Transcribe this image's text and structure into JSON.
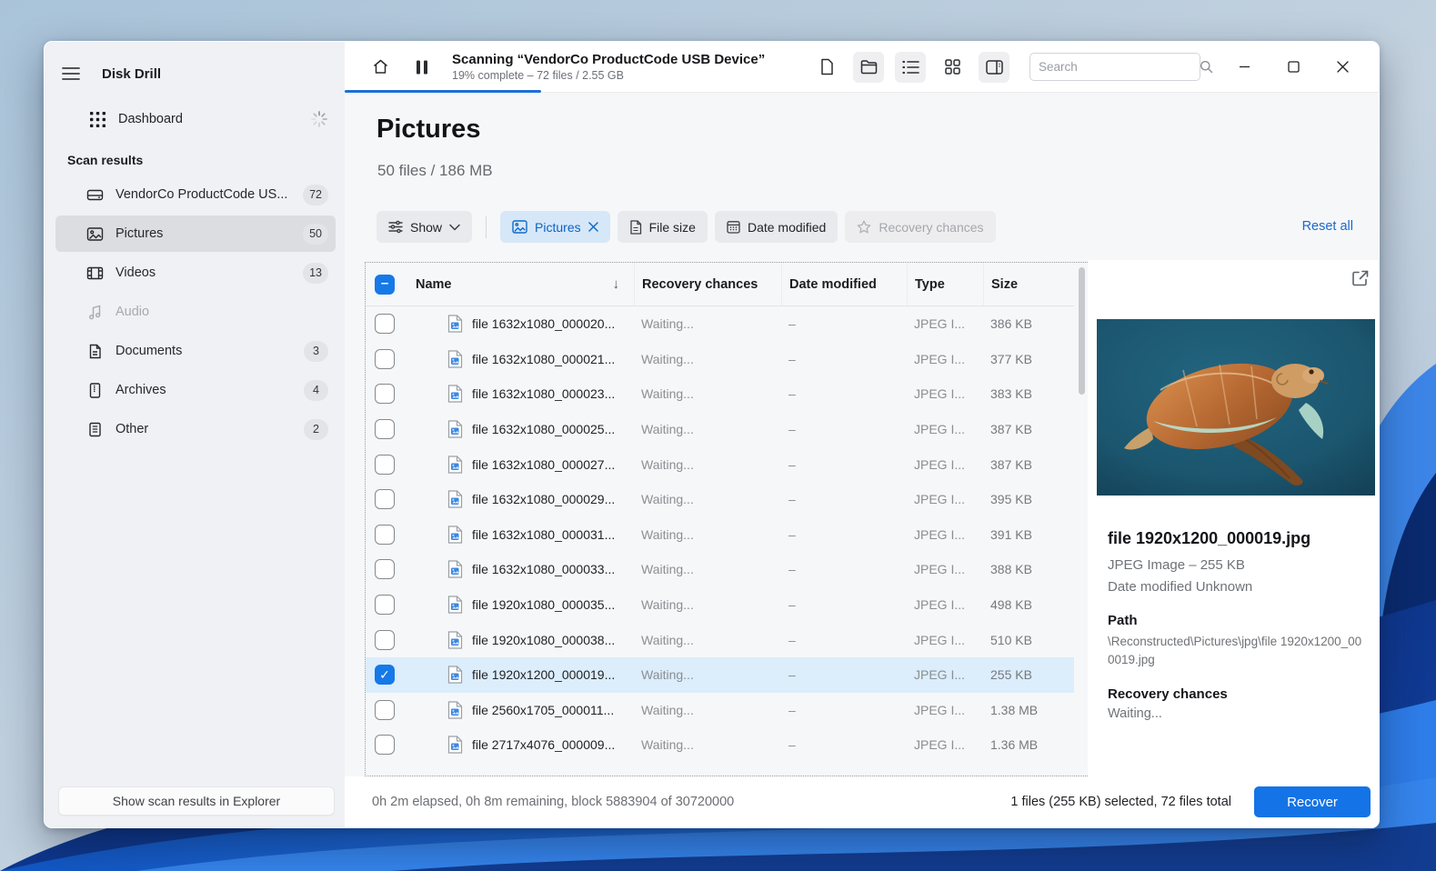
{
  "app": {
    "title": "Disk Drill"
  },
  "sidebar": {
    "dashboard_label": "Dashboard",
    "section_title": "Scan results",
    "items": [
      {
        "label": "VendorCo ProductCode US...",
        "count": "72"
      },
      {
        "label": "Pictures",
        "count": "50"
      },
      {
        "label": "Videos",
        "count": "13"
      },
      {
        "label": "Audio",
        "count": ""
      },
      {
        "label": "Documents",
        "count": "3"
      },
      {
        "label": "Archives",
        "count": "4"
      },
      {
        "label": "Other",
        "count": "2"
      }
    ],
    "footer_button": "Show scan results in Explorer"
  },
  "topbar": {
    "scan_title": "Scanning “VendorCo ProductCode USB Device”",
    "scan_subtitle": "19% complete – 72 files / 2.55 GB",
    "progress_percent": 19,
    "search_placeholder": "Search"
  },
  "header": {
    "title": "Pictures",
    "subtitle": "50 files / 186 MB"
  },
  "filters": {
    "show_label": "Show",
    "pictures_chip": "Pictures",
    "file_size_chip": "File size",
    "date_modified_chip": "Date modified",
    "recovery_chances_chip": "Recovery chances",
    "reset_all": "Reset all"
  },
  "table": {
    "columns": [
      "Name",
      "Recovery chances",
      "Date modified",
      "Type",
      "Size"
    ],
    "rows": [
      {
        "name": "file 1632x1080_000020...",
        "recovery": "Waiting...",
        "date": "–",
        "type": "JPEG I...",
        "size": "386 KB",
        "selected": false
      },
      {
        "name": "file 1632x1080_000021...",
        "recovery": "Waiting...",
        "date": "–",
        "type": "JPEG I...",
        "size": "377 KB",
        "selected": false
      },
      {
        "name": "file 1632x1080_000023...",
        "recovery": "Waiting...",
        "date": "–",
        "type": "JPEG I...",
        "size": "383 KB",
        "selected": false
      },
      {
        "name": "file 1632x1080_000025...",
        "recovery": "Waiting...",
        "date": "–",
        "type": "JPEG I...",
        "size": "387 KB",
        "selected": false
      },
      {
        "name": "file 1632x1080_000027...",
        "recovery": "Waiting...",
        "date": "–",
        "type": "JPEG I...",
        "size": "387 KB",
        "selected": false
      },
      {
        "name": "file 1632x1080_000029...",
        "recovery": "Waiting...",
        "date": "–",
        "type": "JPEG I...",
        "size": "395 KB",
        "selected": false
      },
      {
        "name": "file 1632x1080_000031...",
        "recovery": "Waiting...",
        "date": "–",
        "type": "JPEG I...",
        "size": "391 KB",
        "selected": false
      },
      {
        "name": "file 1632x1080_000033...",
        "recovery": "Waiting...",
        "date": "–",
        "type": "JPEG I...",
        "size": "388 KB",
        "selected": false
      },
      {
        "name": "file 1920x1080_000035...",
        "recovery": "Waiting...",
        "date": "–",
        "type": "JPEG I...",
        "size": "498 KB",
        "selected": false
      },
      {
        "name": "file 1920x1080_000038...",
        "recovery": "Waiting...",
        "date": "–",
        "type": "JPEG I...",
        "size": "510 KB",
        "selected": false
      },
      {
        "name": "file 1920x1200_000019...",
        "recovery": "Waiting...",
        "date": "–",
        "type": "JPEG I...",
        "size": "255 KB",
        "selected": true
      },
      {
        "name": "file 2560x1705_000011...",
        "recovery": "Waiting...",
        "date": "–",
        "type": "JPEG I...",
        "size": "1.38 MB",
        "selected": false
      },
      {
        "name": "file 2717x4076_000009...",
        "recovery": "Waiting...",
        "date": "–",
        "type": "JPEG I...",
        "size": "1.36 MB",
        "selected": false
      }
    ]
  },
  "preview": {
    "filename": "file 1920x1200_000019.jpg",
    "meta_type_size": "JPEG Image – 255 KB",
    "meta_date": "Date modified Unknown",
    "path_label": "Path",
    "path_value": "\\Reconstructed\\Pictures\\jpg\\file 1920x1200_000019.jpg",
    "recovery_label": "Recovery chances",
    "recovery_value": "Waiting..."
  },
  "statusbar": {
    "left": "0h 2m elapsed, 0h 8m remaining, block 5883904 of 30720000",
    "right": "1 files (255 KB) selected, 72 files total",
    "recover_button": "Recover"
  },
  "colors": {
    "accent": "#1473e6",
    "progress": "#1b6fd6",
    "selected_row": "#dcedfb",
    "chip_active_bg": "#d6e7f8",
    "chip_active_text": "#0b63c5"
  }
}
